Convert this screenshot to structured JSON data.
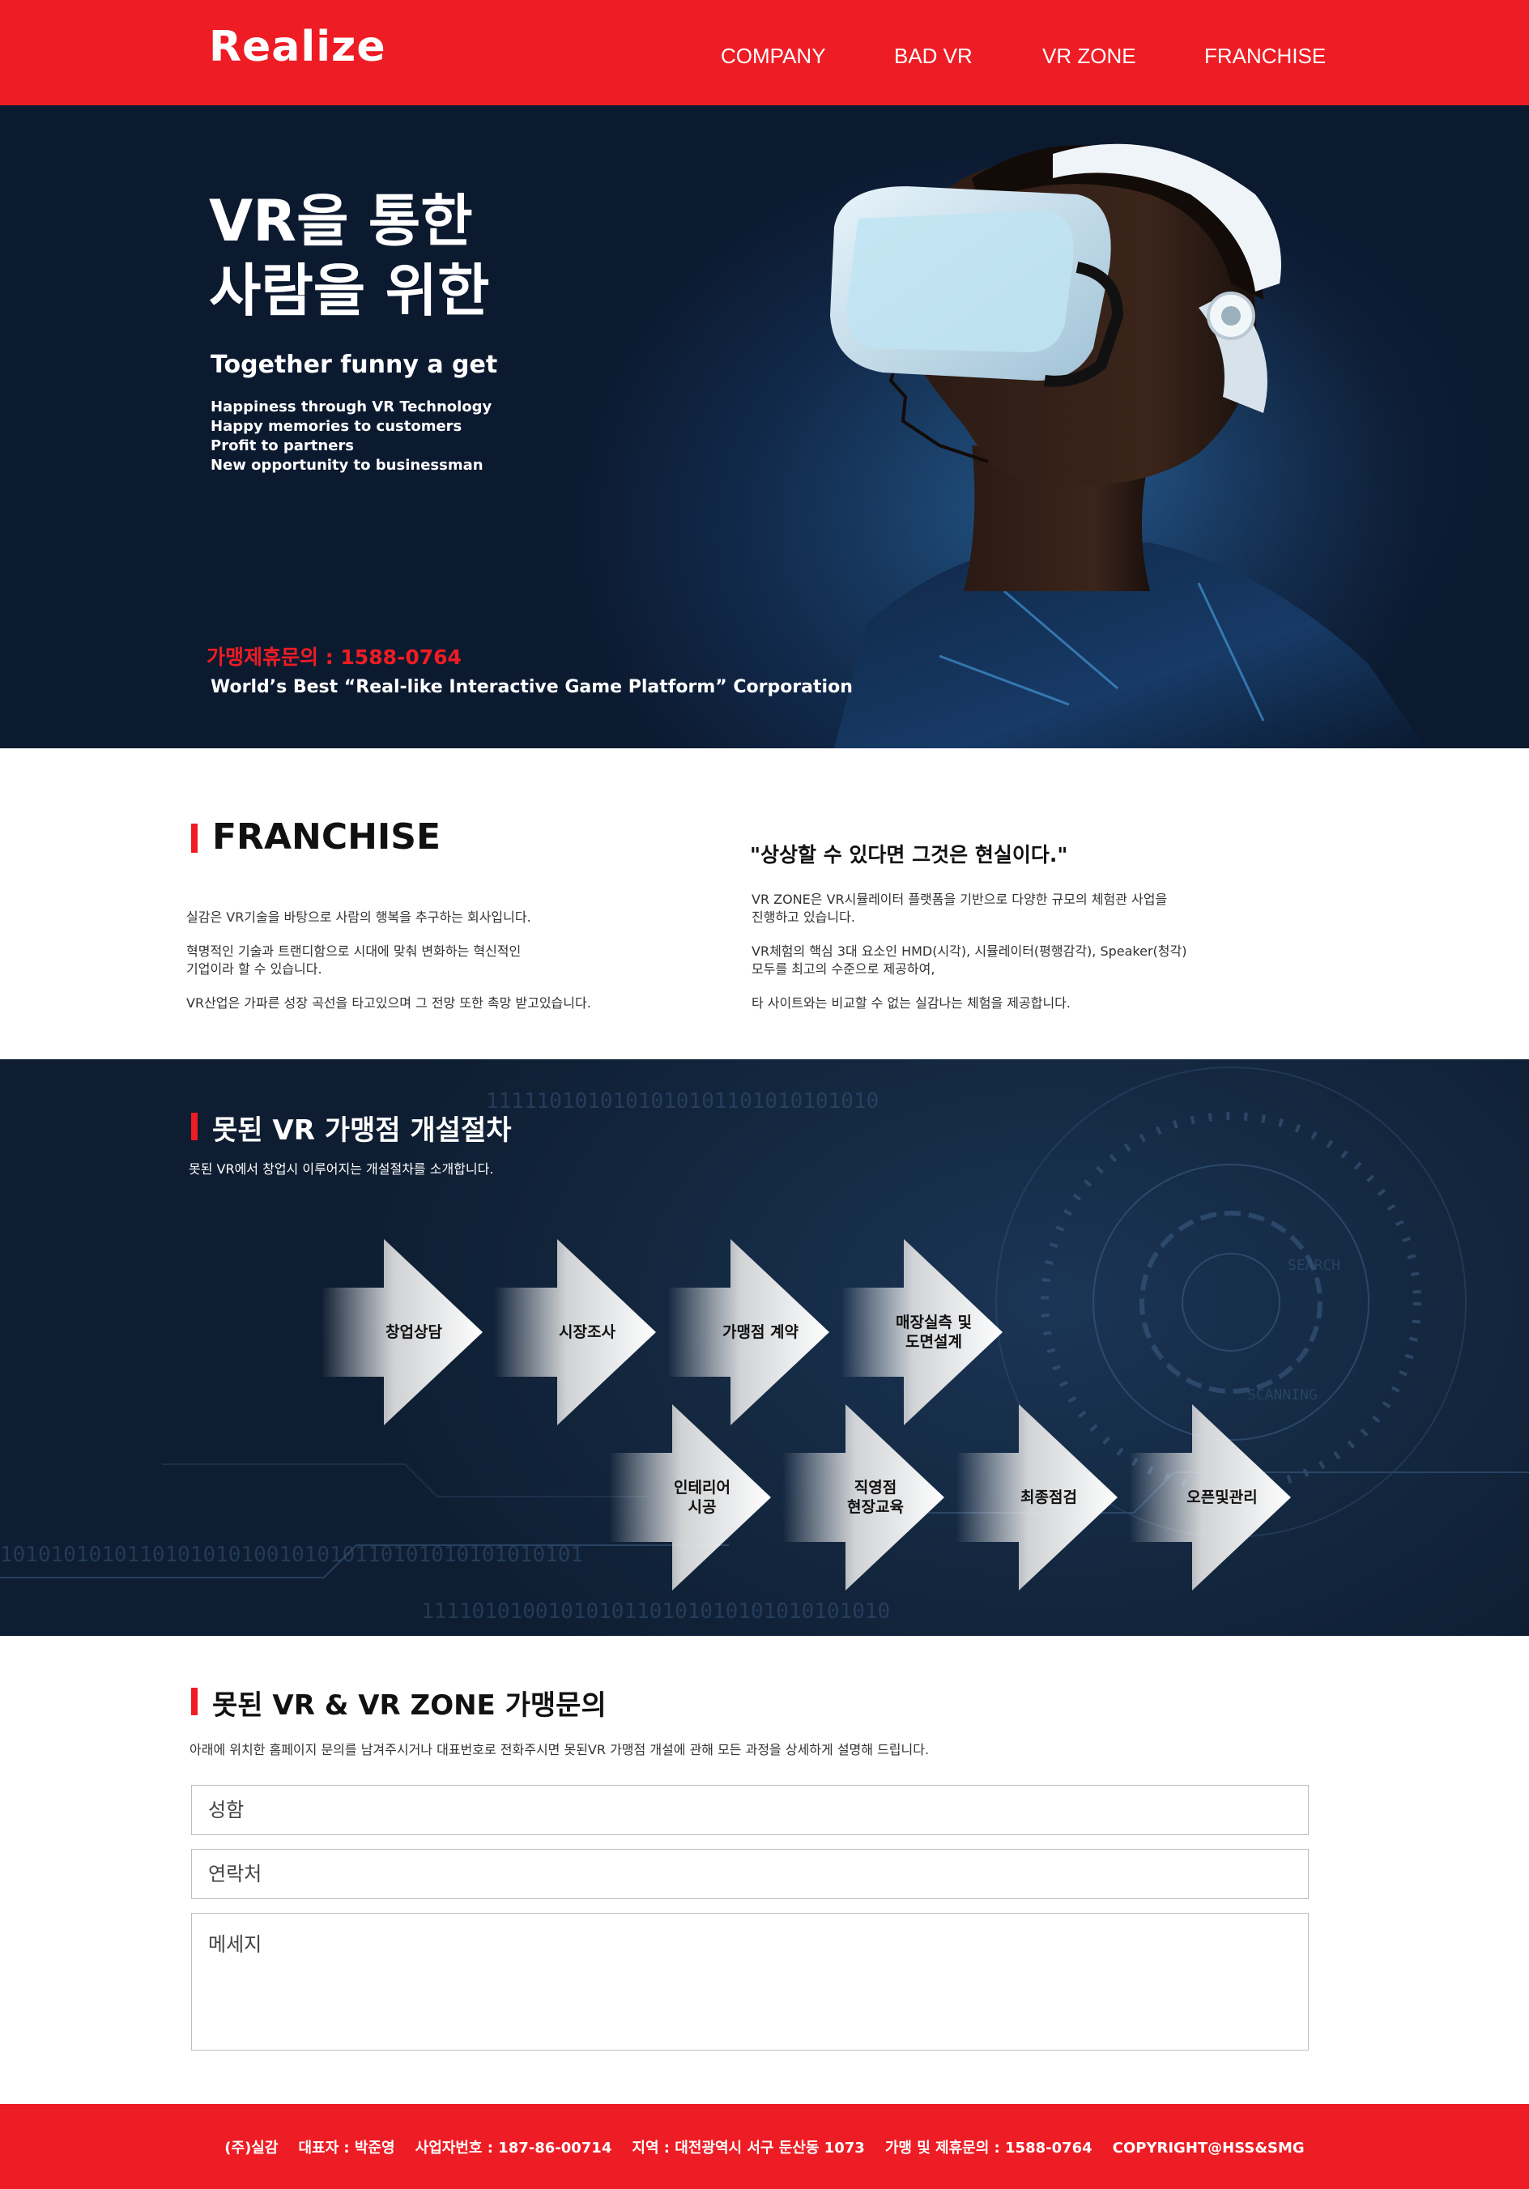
{
  "header": {
    "logo": "Realize",
    "nav": [
      "COMPANY",
      "BAD VR",
      "VR ZONE",
      "FRANCHISE"
    ]
  },
  "hero": {
    "title_line1": "VR을 통한",
    "title_line2": "사람을 위한",
    "tagline": "Together funny a get",
    "lines": [
      "Happiness through VR Technology",
      "Happy memories to customers",
      "Profit to partners",
      "New opportunity to businessman"
    ],
    "phone": "가맹제휴문의 : 1588-0764",
    "corporation": "World’s Best “Real-like Interactive Game Platform” Corporation"
  },
  "franchise": {
    "title": "FRANCHISE",
    "left_paragraphs": [
      "실감은 VR기술을 바탕으로 사람의 행복을 추구하는 회사입니다.",
      "혁명적인 기술과 트랜디함으로 시대에 맞춰 변화하는  혁신적인",
      "기업이라 할 수 있습니다.",
      "VR산업은 가파른 성장 곡선을 타고있으며 그 전망 또한 촉망 받고있습니다."
    ],
    "quote": "\"상상할 수 있다면 그것은 현실이다.\"",
    "right_paragraphs": [
      "VR ZONE은  VR시뮬레이터 플랫폼을 기반으로 다양한 규모의 체험관 사업을",
      "진행하고 있습니다.",
      "VR체험의 핵심 3대 요소인 HMD(시각), 시뮬레이터(평행감각), Speaker(청각)",
      "모두를 최고의 수준으로 제공하여,",
      "타 사이트와는 비교할 수 없는 실감나는 체험을 제공합니다."
    ]
  },
  "process": {
    "title": "못된 VR 가맹점 개설절차",
    "subtitle": "못된 VR에서 창업시 이루어지는 개설절차를 소개합니다.",
    "steps": [
      {
        "line1": "창업상담",
        "line2": ""
      },
      {
        "line1": "시장조사",
        "line2": ""
      },
      {
        "line1": "가맹점 계약",
        "line2": ""
      },
      {
        "line1": "매장실측 및",
        "line2": "도면설계"
      },
      {
        "line1": "인테리어",
        "line2": "시공"
      },
      {
        "line1": "직영점",
        "line2": "현장교육"
      },
      {
        "line1": "최종점검",
        "line2": ""
      },
      {
        "line1": "오픈및관리",
        "line2": ""
      }
    ]
  },
  "contact": {
    "title": "못된 VR & VR ZONE 가맹문의",
    "description": "아래에 위치한 홈페이지 문의를 남겨주시거나 대표번호로 전화주시면 못된VR 가맹점 개설에 관해 모든 과정을 상세하게 설명해 드립니다.",
    "name_placeholder": "성함",
    "phone_placeholder": "연락처",
    "message_placeholder": "메세지"
  },
  "footer": {
    "text": "(주)실감    대표자 : 박준영    사업자번호 : 187-86-00714    지역 : 대전광역시 서구 둔산동 1073    가맹 및 제휴문의 : 1588-0764    COPYRIGHT@HSS&SMG"
  },
  "colors": {
    "brand_red": "#ee1c24",
    "navy": "#0e1d31"
  }
}
